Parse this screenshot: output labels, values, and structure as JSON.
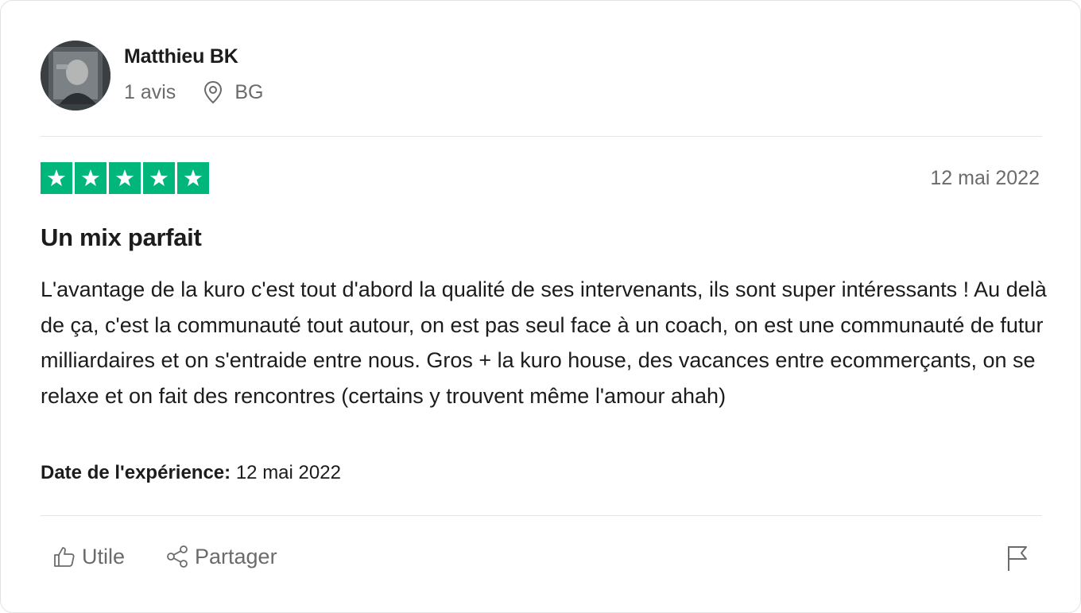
{
  "reviewer": {
    "name": "Matthieu BK",
    "review_count": "1 avis",
    "country": "BG"
  },
  "review": {
    "rating": 5,
    "max_rating": 5,
    "date": "12 mai 2022",
    "title": "Un mix parfait",
    "body": "L'avantage de la kuro c'est tout d'abord la qualité de ses intervenants, ils sont super intéressants ! Au delà de ça, c'est la communauté tout autour, on est pas seul face à un coach, on est une communauté de futur milliardaires et on s'entraide entre nous. Gros + la kuro house, des vacances entre ecommerçants, on se relaxe et on fait des rencontres (certains y trouvent même l'amour ahah)",
    "experience_label": "Date de l'expérience:",
    "experience_date": "12 mai 2022"
  },
  "actions": {
    "useful_label": "Utile",
    "share_label": "Partager"
  },
  "icons": {
    "location": "location-pin-icon",
    "star": "star-icon",
    "useful": "thumbs-up-icon",
    "share": "share-icon",
    "report": "flag-icon"
  },
  "colors": {
    "star_background": "#00b67a",
    "text_primary": "#1c1c1c",
    "text_secondary": "#6b6b6b"
  }
}
